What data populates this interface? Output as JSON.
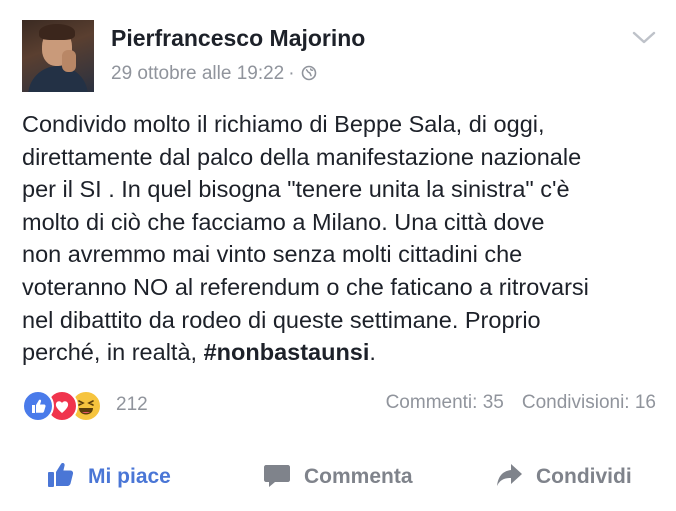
{
  "post": {
    "author": "Pierfrancesco Majorino",
    "timestamp": "29 ottobre alle 19:22",
    "separator": "·",
    "privacy_icon": "globe-icon",
    "menu_icon": "chevron-down-icon",
    "text": "Condivido molto il richiamo di Beppe Sala, di oggi,\ndirettamente dal palco della manifestazione nazionale\nper il SI . In quel bisogna \"tenere unita la sinistra\" c'è\nmolto di ciò che facciamo a Milano. Una città dove\nnon avremmo mai vinto senza molti cittadini che\nvoteranno NO al referendum o che faticano a ritrovarsi\nnel dibattito da rodeo di queste settimane. Proprio\nperché, in realtà,  ",
    "hashtag": "#nonbastaunsi",
    "text_end": "."
  },
  "stats": {
    "reaction_icons": [
      "like-reaction-icon",
      "love-reaction-icon",
      "haha-reaction-icon"
    ],
    "reaction_count": "212",
    "comments": "Commenti: 35",
    "shares": "Condivisioni: 16"
  },
  "actions": {
    "like_label": "Mi piace",
    "comment_label": "Commenta",
    "share_label": "Condividi"
  },
  "colors": {
    "accent": "#4a76d6",
    "like_reaction": "#4a7bea",
    "love_reaction": "#f0344d",
    "haha_reaction": "#f6c43e",
    "meta_gray": "#90949c"
  }
}
